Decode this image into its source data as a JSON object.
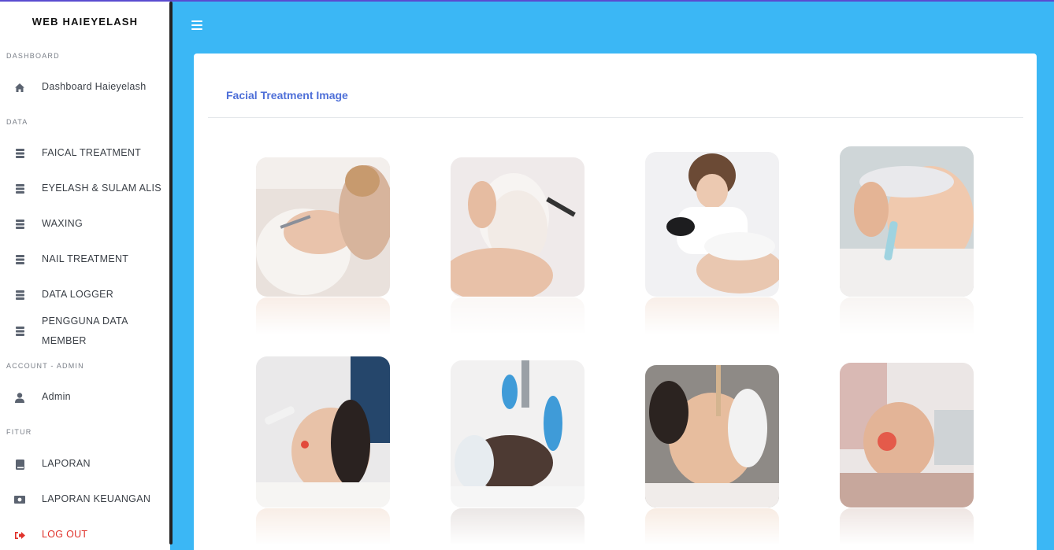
{
  "sidebar": {
    "brand": "WEB HAIEYELASH",
    "sections": [
      {
        "heading": "DASHBOARD"
      },
      {
        "heading": "DATA"
      },
      {
        "heading": "ACCOUNT - ADMIN"
      },
      {
        "heading": "FITUR"
      }
    ],
    "items": [
      {
        "label": "Dashboard Haieyelash",
        "icon": "home-icon"
      },
      {
        "label": "FAICAL TREATMENT",
        "icon": "database-icon"
      },
      {
        "label": "EYELASH & SULAM ALIS",
        "icon": "database-icon"
      },
      {
        "label": "WAXING",
        "icon": "database-icon"
      },
      {
        "label": "NAIL TREATMENT",
        "icon": "database-icon"
      },
      {
        "label": "DATA LOGGER",
        "icon": "database-icon"
      },
      {
        "label": "PENGGUNA DATA",
        "label2": "MEMBER",
        "icon": "database-icon"
      },
      {
        "label": "Admin",
        "icon": "user-icon"
      },
      {
        "label": "LAPORAN",
        "icon": "book-icon"
      },
      {
        "label": "LAPORAN KEUANGAN",
        "icon": "money-icon"
      },
      {
        "label": "LOG OUT",
        "icon": "sign-out-icon"
      }
    ]
  },
  "main": {
    "card_title": "Facial Treatment Image",
    "images": [
      {
        "alt": "facial treatment photo 1"
      },
      {
        "alt": "facial treatment photo 2"
      },
      {
        "alt": "facial treatment photo 3"
      },
      {
        "alt": "facial treatment photo 4"
      },
      {
        "alt": "facial treatment photo 5"
      },
      {
        "alt": "facial treatment photo 6"
      },
      {
        "alt": "facial treatment photo 7"
      },
      {
        "alt": "facial treatment photo 8"
      }
    ]
  },
  "colors": {
    "topbar": "#3bb7f5",
    "accent_title": "#4e6fd8",
    "logout": "#e0322b"
  }
}
